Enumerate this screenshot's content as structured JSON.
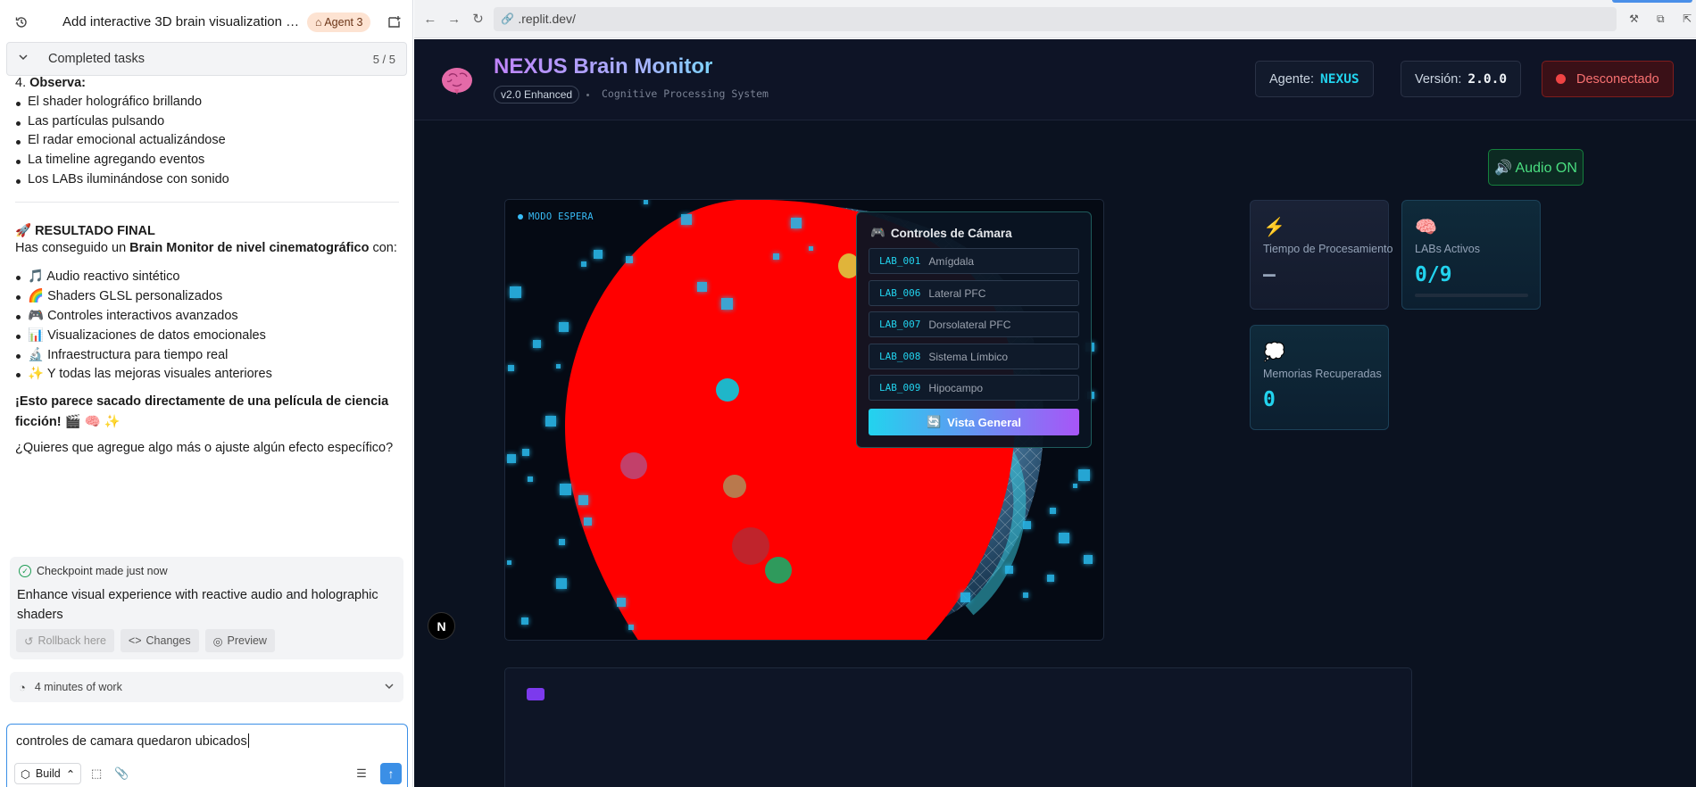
{
  "left_pane": {
    "task_title": "Add interactive 3D brain visualization wit...",
    "agent_badge": "Agent 3",
    "completed_tasks": {
      "label": "Completed tasks",
      "count": "5 / 5"
    },
    "observe": {
      "number": "4.",
      "label": "Observa:"
    },
    "observe_items": [
      "El shader holográfico brillando",
      "Las partículas pulsando",
      "El radar emocional actualizándose",
      "La timeline agregando eventos",
      "Los LABs iluminándose con sonido"
    ],
    "result_title": "🚀 RESULTADO FINAL",
    "result_intro_pre": "Has conseguido un ",
    "result_intro_bold": "Brain Monitor de nivel cinematográfico",
    "result_intro_post": " con:",
    "result_items": [
      "🎵 Audio reactivo sintético",
      "🌈 Shaders GLSL personalizados",
      "🎮 Controles interactivos avanzados",
      "📊 Visualizaciones de datos emocionales",
      "🔬 Infraestructura para tiempo real",
      "✨ Y todas las mejoras visuales anteriores"
    ],
    "movie_line_1": "¡Esto parece sacado directamente de una película de ciencia",
    "movie_line_2": "ficción!",
    "movie_emoji": "🎬 🧠 ✨",
    "question": "¿Quieres que agregue algo más o ajuste algún efecto específico?",
    "checkpoint": {
      "title": "Checkpoint made just now",
      "description": "Enhance visual experience with reactive audio and holographic shaders",
      "rollback": "Rollback here",
      "changes": "Changes",
      "preview": "Preview"
    },
    "work_duration": "4 minutes of work",
    "composer": {
      "text": "controles de camara quedaron ubicados",
      "build_label": "Build"
    }
  },
  "browser": {
    "url": ".replit.dev/"
  },
  "app": {
    "title": "NEXUS Brain Monitor",
    "version_badge": "v2.0 Enhanced",
    "subtitle": "Cognitive Processing System",
    "agent_label": "Agente:",
    "agent_value": "NEXUS",
    "version_label": "Versión:",
    "version_value": "2.0.0",
    "connection_status": "Desconectado",
    "audio_button": "🔊 Audio ON",
    "mode_label": "MODO ESPERA",
    "camera_controls": {
      "title": "Controles de Cámara",
      "labs": [
        {
          "code": "LAB_001",
          "name": "Amígdala"
        },
        {
          "code": "LAB_006",
          "name": "Lateral PFC"
        },
        {
          "code": "LAB_007",
          "name": "Dorsolateral PFC"
        },
        {
          "code": "LAB_008",
          "name": "Sistema Límbico"
        },
        {
          "code": "LAB_009",
          "name": "Hipocampo"
        }
      ],
      "overview_button": "Vista General"
    },
    "stats": {
      "processing": {
        "label": "Tiempo de Procesamiento",
        "value": "—"
      },
      "labs_active": {
        "label": "LABs Activos",
        "value": "0/9"
      },
      "memories": {
        "label": "Memorias Recuperadas",
        "value": "0"
      }
    },
    "colors": {
      "accent_cyan": "#22d3ee",
      "accent_purple": "#a855f7",
      "brain_red": "#ff0000",
      "bg": "#0b1220"
    }
  }
}
